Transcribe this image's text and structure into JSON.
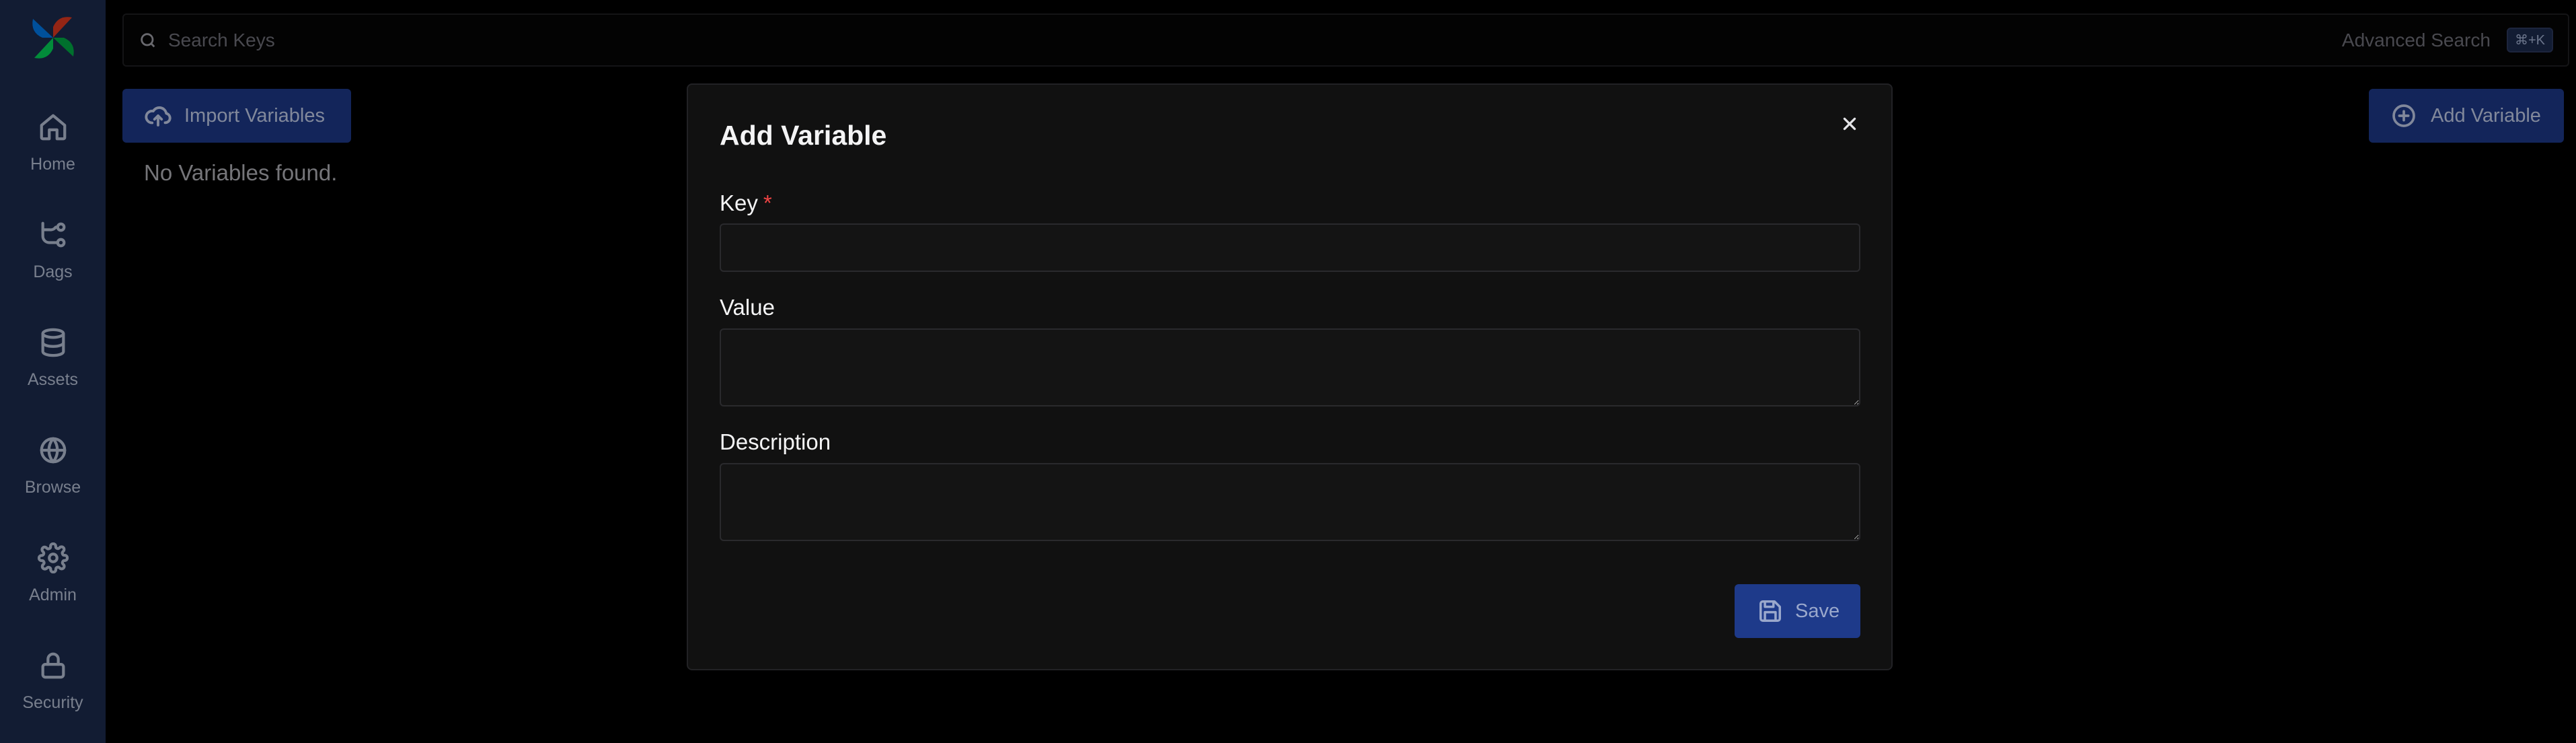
{
  "sidebar": {
    "items": [
      {
        "label": "Home",
        "icon": "home-icon"
      },
      {
        "label": "Dags",
        "icon": "dags-icon"
      },
      {
        "label": "Assets",
        "icon": "database-icon"
      },
      {
        "label": "Browse",
        "icon": "globe-icon"
      },
      {
        "label": "Admin",
        "icon": "gear-icon"
      },
      {
        "label": "Security",
        "icon": "lock-icon"
      }
    ]
  },
  "search": {
    "placeholder": "Search Keys",
    "advanced_label": "Advanced Search",
    "shortcut": "⌘+K"
  },
  "toolbar": {
    "import_label": "Import Variables",
    "add_label": "Add Variable"
  },
  "main": {
    "empty_message": "No Variables found."
  },
  "modal": {
    "title": "Add Variable",
    "key_label": "Key",
    "required_mark": "*",
    "value_label": "Value",
    "description_label": "Description",
    "key_value": "",
    "value_value": "",
    "description_value": "",
    "save_label": "Save"
  },
  "colors": {
    "sidebar_bg": "#1c2b4f",
    "primary_button": "#1e3a8a",
    "required": "#ef4444",
    "modal_bg": "#111111"
  }
}
